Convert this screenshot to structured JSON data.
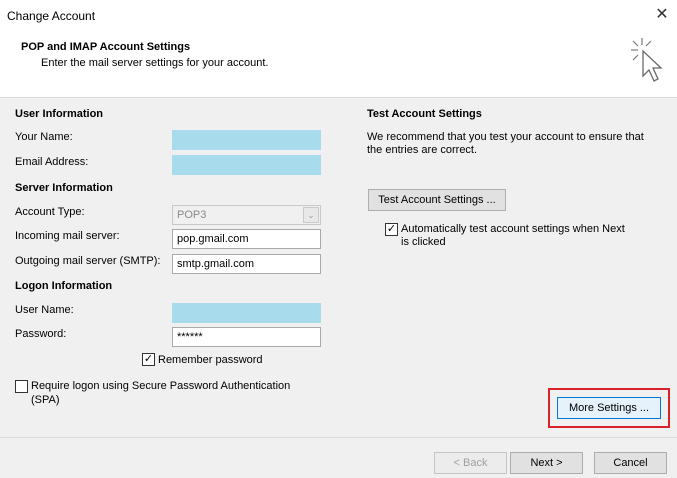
{
  "window": {
    "title": "Change Account",
    "close_glyph": "✕"
  },
  "header": {
    "title": "POP and IMAP Account Settings",
    "subtitle": "Enter the mail server settings for your account.",
    "icon": "cursor-sparkle-icon"
  },
  "user_info": {
    "heading": "User Information",
    "your_name_label": "Your Name:",
    "your_name_value": "",
    "email_label": "Email Address:",
    "email_value": ""
  },
  "server_info": {
    "heading": "Server Information",
    "account_type_label": "Account Type:",
    "account_type_value": "POP3",
    "incoming_label": "Incoming mail server:",
    "incoming_value": "pop.gmail.com",
    "outgoing_label": "Outgoing mail server (SMTP):",
    "outgoing_value": "smtp.gmail.com"
  },
  "logon_info": {
    "heading": "Logon Information",
    "username_label": "User Name:",
    "username_value": "",
    "password_label": "Password:",
    "password_value": "******",
    "remember_label": "Remember password",
    "remember_checked": true,
    "spa_label_line1": "Require logon using Secure Password Authentication",
    "spa_label_line2": "(SPA)",
    "spa_checked": false
  },
  "test_settings": {
    "heading": "Test Account Settings",
    "description_line1": "We recommend that you test your account to ensure that",
    "description_line2": "the entries are correct.",
    "test_button": "Test Account Settings ...",
    "auto_test_line1": "Automatically test account settings when Next",
    "auto_test_line2": "is clicked",
    "auto_test_checked": true
  },
  "more_settings_button": "More Settings ...",
  "footer": {
    "back_button": "< Back",
    "next_button": "Next >",
    "cancel_button": "Cancel"
  },
  "colors": {
    "filled_field": "#a8dced",
    "highlight": "#d8232a",
    "focus_border": "#0078d7"
  }
}
